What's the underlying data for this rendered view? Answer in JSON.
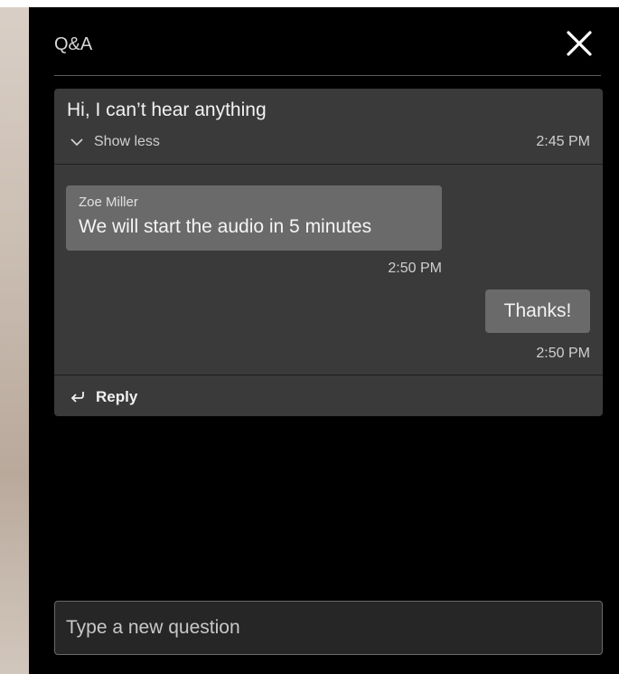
{
  "panel": {
    "title": "Q&A",
    "close_icon": "close-icon"
  },
  "thread": {
    "question": {
      "text": "Hi, I can’t hear anything",
      "toggle_label": "Show less",
      "toggle_icon": "chevron-down-icon",
      "time": "2:45 PM"
    },
    "answers": [
      {
        "sender": "Zoe Miller",
        "text": "We will start the audio in 5 minutes",
        "time": "2:50 PM"
      },
      {
        "sender": "",
        "text": "Thanks!",
        "time": "2:50 PM"
      }
    ],
    "reply_label": "Reply",
    "reply_icon": "reply-arrow-icon"
  },
  "composer": {
    "placeholder": "Type a new question"
  },
  "colors": {
    "panel_bg": "#000000",
    "card_bg": "#3a3a3a",
    "bubble_bg": "#6a6a6a"
  }
}
